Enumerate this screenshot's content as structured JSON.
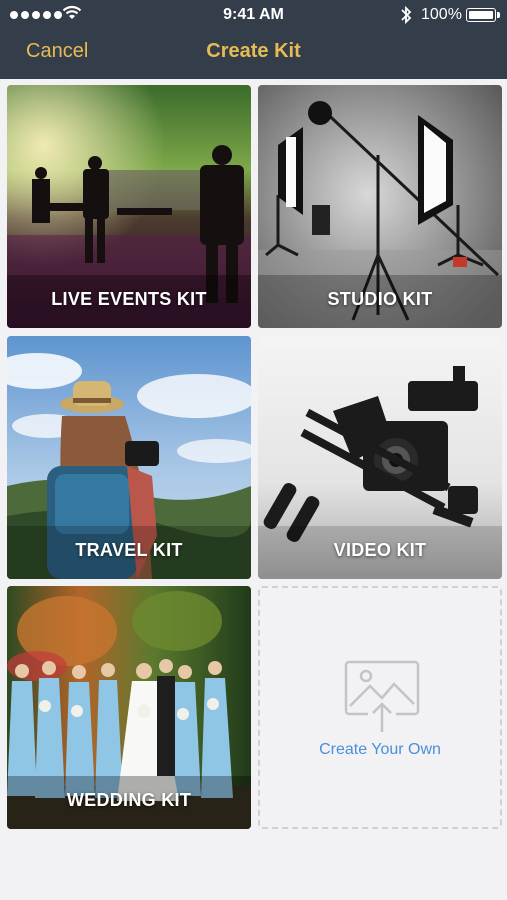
{
  "status_bar": {
    "time": "9:41 AM",
    "battery_percent": "100%",
    "signal_dots": 5
  },
  "nav": {
    "cancel_label": "Cancel",
    "title": "Create Kit"
  },
  "colors": {
    "header_bg": "#343d4a",
    "accent_gold": "#e6bb52",
    "link_blue": "#4a8fd8",
    "page_bg": "#f2f2f4"
  },
  "kits": [
    {
      "label": "LIVE EVENTS KIT"
    },
    {
      "label": "STUDIO KIT"
    },
    {
      "label": "TRAVEL KIT"
    },
    {
      "label": "VIDEO KIT"
    },
    {
      "label": "WEDDING KIT"
    }
  ],
  "create_own": {
    "label": "Create Your Own",
    "icon": "image-upload-icon"
  }
}
